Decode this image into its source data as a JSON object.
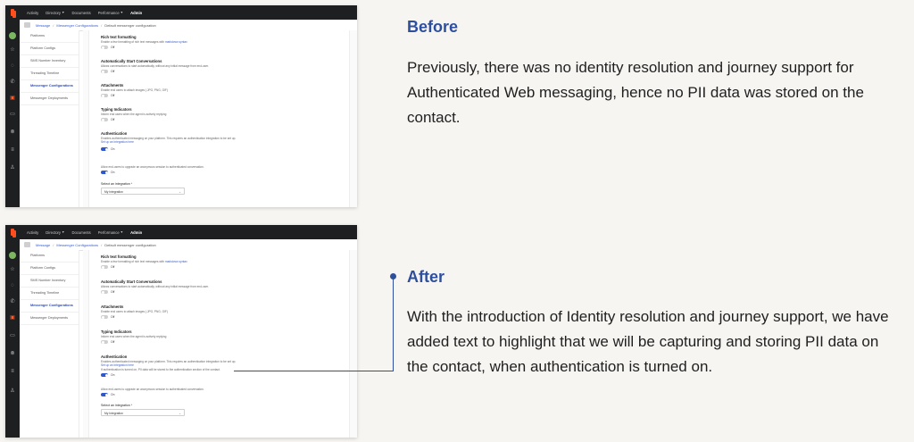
{
  "app": {
    "nav": [
      {
        "label": "Activity",
        "caret": false
      },
      {
        "label": "Directory",
        "caret": true
      },
      {
        "label": "Documents",
        "caret": false
      },
      {
        "label": "Performance",
        "caret": true
      },
      {
        "label": "Admin",
        "caret": false,
        "active": true
      }
    ],
    "breadcrumb": [
      "Message",
      "Messenger Configurations",
      "Default messenger configuration"
    ],
    "sidebar": [
      {
        "label": "Platforms"
      },
      {
        "label": "Platform Configs"
      },
      {
        "label": "SMS Number Inventory"
      },
      {
        "label": "Threading Timeline"
      },
      {
        "label": "Messenger Configurations",
        "active": true
      },
      {
        "label": "Messenger Deployments"
      }
    ],
    "sections": {
      "rich_text": {
        "title": "Rich text formatting",
        "desc": "Enable a few formatting of rich text messages with",
        "link": "markdown syntax",
        "toggle": "Off"
      },
      "auto_start": {
        "title": "Automatically Start Conversations",
        "desc": "Allows conversations to start automatically, without any initial message from end-user.",
        "toggle": "Off"
      },
      "attachments": {
        "title": "Attachments",
        "desc": "Enable end users to attach images (.JPG, PNG, GIF)",
        "toggle": "Off"
      },
      "typing": {
        "title": "Typing Indicators",
        "desc": "Inform end users when the agent is actively replying",
        "toggle": "Off"
      },
      "auth": {
        "title": "Authentication",
        "desc": "Enables authenticated messaging on your platform. This requires an authentication integration to be set up.",
        "link": "Set up an Integration here",
        "pii_note": "If authentication is turned on, PII data will be stored to the authentication section of the contact.",
        "toggle": "On"
      },
      "upgrade": {
        "desc": "Allow end-users to upgrade an anonymous session to authenticated conversation.",
        "toggle": "On"
      },
      "integration": {
        "label": "Select an integration",
        "required": "*",
        "value": "My Integration"
      }
    }
  },
  "before": {
    "heading": "Before",
    "text": "Previously, there was no identity resolution and journey support for Authenticated Web messaging, hence no PII data was stored on the contact."
  },
  "after": {
    "heading": "After",
    "text": "With the introduction of Identity resolution and journey support, we have added text to highlight that we will be capturing and storing PII data on the contact, when authentication is turned on."
  }
}
